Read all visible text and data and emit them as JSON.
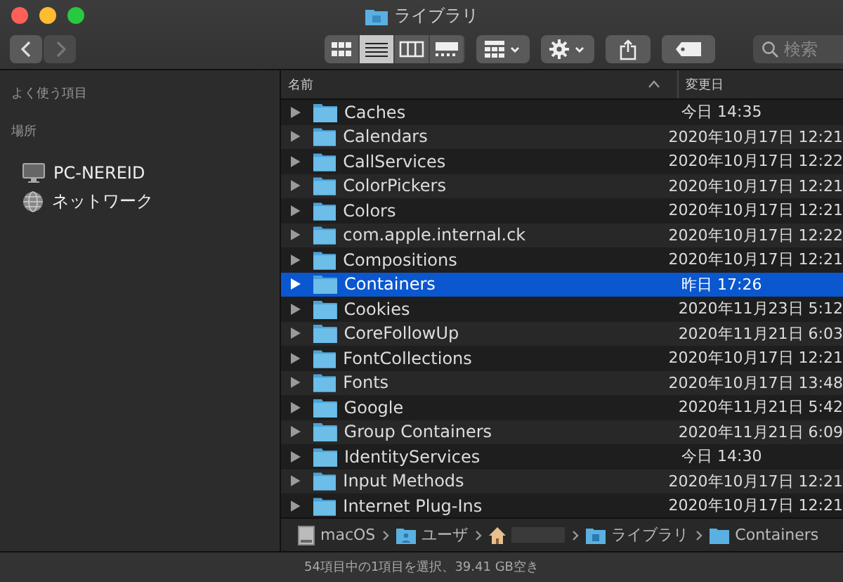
{
  "window": {
    "title": "ライブラリ"
  },
  "toolbar": {
    "view_modes": [
      {
        "kind": "icons",
        "selected": false
      },
      {
        "kind": "list",
        "selected": true
      },
      {
        "kind": "columns",
        "selected": false
      },
      {
        "kind": "gallery",
        "selected": false
      }
    ],
    "search": {
      "placeholder": "検索"
    }
  },
  "sidebar": {
    "sections": [
      {
        "title": "よく使う項目"
      },
      {
        "title": "場所",
        "items": [
          {
            "kind": "computer",
            "label": "PC-NEREID"
          },
          {
            "kind": "network",
            "label": "ネットワーク"
          }
        ]
      }
    ]
  },
  "table": {
    "columns": [
      {
        "label": "名前",
        "sorted": true
      },
      {
        "label": "変更日",
        "sorted": false
      }
    ],
    "rows": [
      {
        "name": "Caches",
        "modified": "今日 14:35",
        "selected": false
      },
      {
        "name": "Calendars",
        "modified": "2020年10月17日 12:21",
        "selected": false
      },
      {
        "name": "CallServices",
        "modified": "2020年10月17日 12:22",
        "selected": false
      },
      {
        "name": "ColorPickers",
        "modified": "2020年10月17日 12:21",
        "selected": false
      },
      {
        "name": "Colors",
        "modified": "2020年10月17日 12:21",
        "selected": false
      },
      {
        "name": "com.apple.internal.ck",
        "modified": "2020年10月17日 12:22",
        "selected": false
      },
      {
        "name": "Compositions",
        "modified": "2020年10月17日 12:21",
        "selected": false
      },
      {
        "name": "Containers",
        "modified": "昨日 17:26",
        "selected": true
      },
      {
        "name": "Cookies",
        "modified": "2020年11月23日 5:12",
        "selected": false
      },
      {
        "name": "CoreFollowUp",
        "modified": "2020年11月21日 6:03",
        "selected": false
      },
      {
        "name": "FontCollections",
        "modified": "2020年10月17日 12:21",
        "selected": false
      },
      {
        "name": "Fonts",
        "modified": "2020年10月17日 13:48",
        "selected": false
      },
      {
        "name": "Google",
        "modified": "2020年11月21日 5:42",
        "selected": false
      },
      {
        "name": "Group Containers",
        "modified": "2020年11月21日 6:09",
        "selected": false
      },
      {
        "name": "IdentityServices",
        "modified": "今日 14:30",
        "selected": false
      },
      {
        "name": "Input Methods",
        "modified": "2020年10月17日 12:21",
        "selected": false
      },
      {
        "name": "Internet Plug-Ins",
        "modified": "2020年10月17日 12:21",
        "selected": false
      }
    ]
  },
  "path_bar": [
    {
      "kind": "disk",
      "label": "macOS"
    },
    {
      "kind": "users",
      "label": "ユーザ"
    },
    {
      "kind": "home"
    },
    {
      "kind": "library",
      "label": "ライブラリ"
    },
    {
      "kind": "folder",
      "label": "Containers"
    }
  ],
  "status_bar": "54項目中の1項目を選択、39.41 GB空き"
}
